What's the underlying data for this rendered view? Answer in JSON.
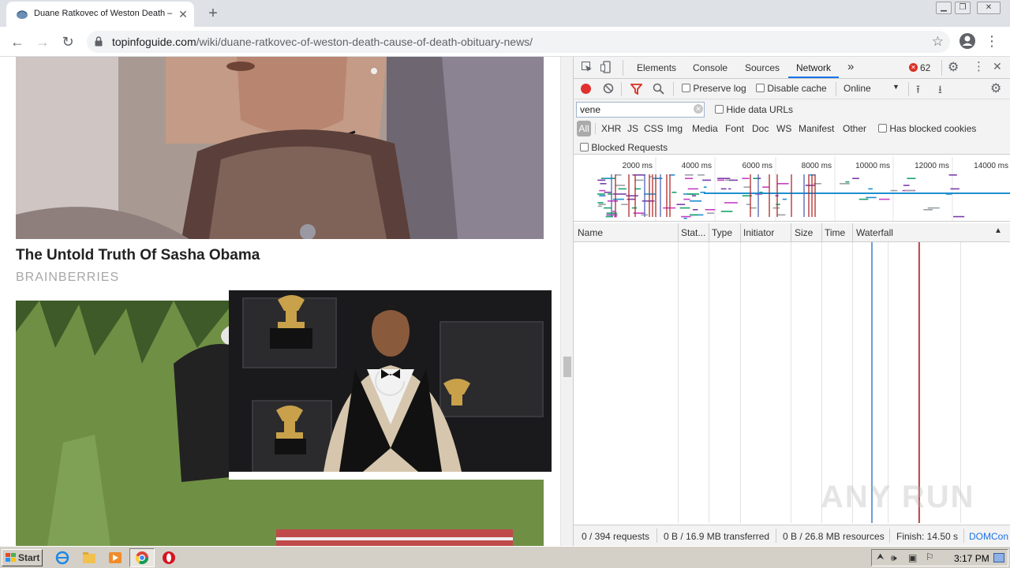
{
  "browser": {
    "tab_title": "Duane Ratkovec of Weston Death –",
    "url_host": "topinfoguide.com",
    "url_path": "/wiki/duane-ratkovec-of-weston-death-cause-of-death-obituary-news/"
  },
  "article": {
    "title": "The Untold Truth Of Sasha Obama",
    "source": "BRAINBERRIES"
  },
  "devtools": {
    "tabs": [
      "Elements",
      "Console",
      "Sources",
      "Network"
    ],
    "error_count": "62",
    "toolbar": {
      "preserve_log": "Preserve log",
      "disable_cache": "Disable cache",
      "throttle": "Online"
    },
    "filter": {
      "value": "vene",
      "hide_data_urls": "Hide data URLs",
      "types": [
        "All",
        "XHR",
        "JS",
        "CSS",
        "Img",
        "Media",
        "Font",
        "Doc",
        "WS",
        "Manifest",
        "Other"
      ],
      "has_blocked_cookies": "Has blocked cookies",
      "blocked_requests": "Blocked Requests"
    },
    "overview_ticks": [
      "2000 ms",
      "4000 ms",
      "6000 ms",
      "8000 ms",
      "10000 ms",
      "12000 ms",
      "14000 ms"
    ],
    "columns": [
      "Name",
      "Stat...",
      "Type",
      "Initiator",
      "Size",
      "Time",
      "Waterfall"
    ],
    "status": {
      "requests": "0 / 394 requests",
      "transferred": "0 B / 16.9 MB transferred",
      "resources": "0 B / 26.8 MB resources",
      "finish": "Finish: 14.50 s",
      "domcontent": "DOMCon"
    }
  },
  "watermark": "ANY RUN",
  "taskbar": {
    "start_label": "Start",
    "clock": "3:17 PM"
  },
  "colors": {
    "record_red": "#e03131",
    "filter_red": "#d93025",
    "waterfall_blue": "#1f8fd0",
    "waterfall_red": "#d14a4a",
    "chrome_tabstrip": "#dee1e6",
    "devtools_panel": "#f3f3f3"
  }
}
